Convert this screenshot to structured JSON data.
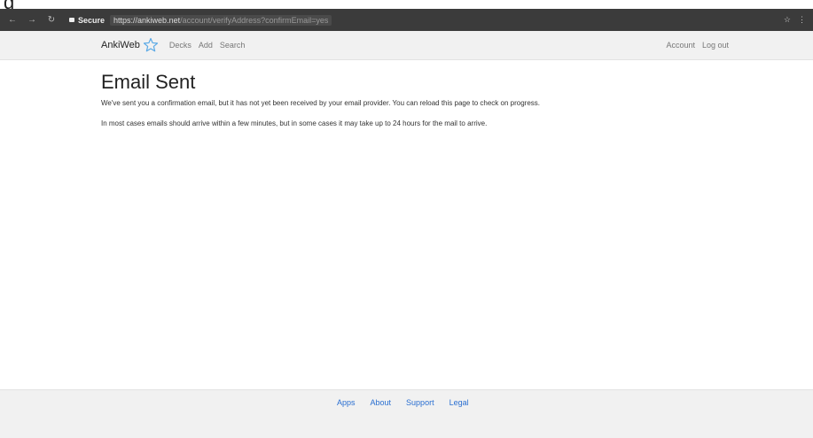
{
  "top_text": "g",
  "browser": {
    "secure_label": "Secure",
    "url_host": "https://ankiweb.net",
    "url_path": "/account/verifyAddress?confirmEmail=yes"
  },
  "header": {
    "brand": "AnkiWeb",
    "nav": [
      "Decks",
      "Add",
      "Search"
    ],
    "right": [
      "Account",
      "Log out"
    ]
  },
  "main": {
    "title": "Email Sent",
    "para1": "We've sent you a confirmation email, but it has not yet been received by your email provider. You can reload this page to check on progress.",
    "para2": "In most cases emails should arrive within a few minutes, but in some cases it may take up to 24 hours for the mail to arrive."
  },
  "footer": {
    "links": [
      "Apps",
      "About",
      "Support",
      "Legal"
    ]
  },
  "colors": {
    "link": "#2a6fd1",
    "brand_star": "#5aa9e6"
  }
}
